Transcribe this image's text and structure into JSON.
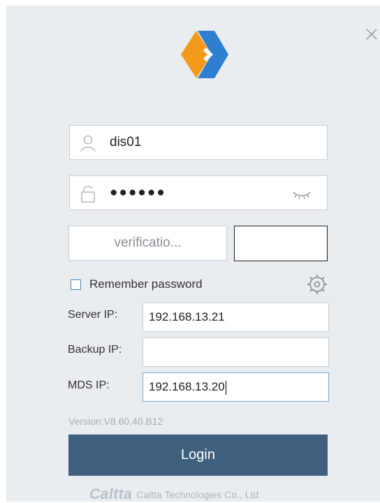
{
  "window": {
    "close_icon": "close-icon"
  },
  "logo": {
    "icon": "app-logo-icon"
  },
  "login": {
    "username_value": "dis01",
    "username_icon": "user-icon",
    "password_mask": "●●●●●●",
    "password_icon": "lock-icon",
    "show_password_icon": "eye-closed-icon",
    "verification_placeholder": "verificatio...",
    "remember_label": "Remember password",
    "remember_checked": false,
    "settings_icon": "gear-icon"
  },
  "network": {
    "server_label": "Server IP:",
    "server_value": "192.168.13.21",
    "backup_label": "Backup IP:",
    "backup_value": "",
    "mds_label": "MDS IP:",
    "mds_value": "192.168.13.20"
  },
  "version": "Version:V8.60.40.B12",
  "login_button": "Login",
  "footer": {
    "brand": "Caltta",
    "company": "Caltta Technologies Co., Ltd"
  },
  "colors": {
    "background": "#e9edf0",
    "button": "#3e5f7e",
    "logo_orange": "#f39a1c",
    "logo_blue": "#2f7fd1"
  }
}
